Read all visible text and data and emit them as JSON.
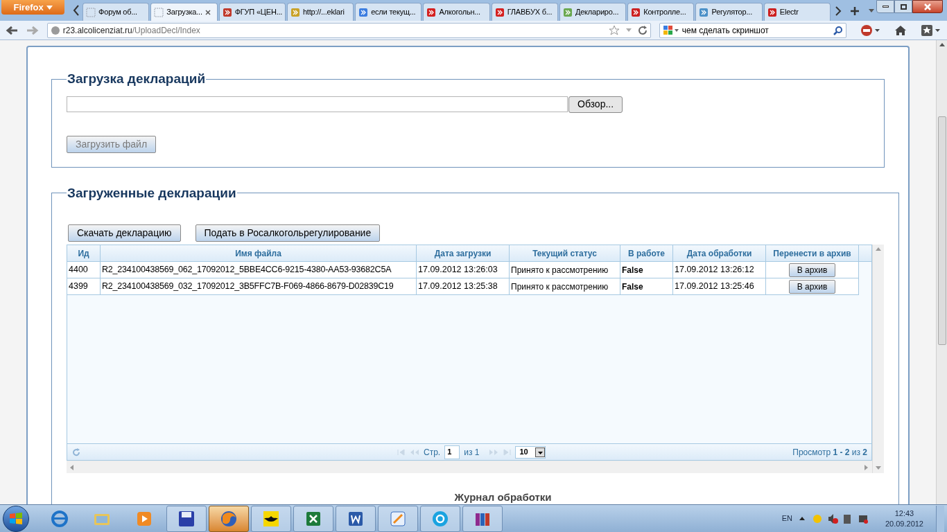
{
  "browser": {
    "menu_button": "Firefox",
    "tabs": [
      {
        "label": "Форум об...",
        "selected": false
      },
      {
        "label": "Загрузка...",
        "selected": true
      },
      {
        "label": "ФГУП «ЦЕН...",
        "selected": false
      },
      {
        "label": "http://...eklari",
        "selected": false
      },
      {
        "label": "если текущ...",
        "selected": false
      },
      {
        "label": "Алкогольн...",
        "selected": false
      },
      {
        "label": "ГЛАВБУХ б...",
        "selected": false
      },
      {
        "label": "Деклариро...",
        "selected": false
      },
      {
        "label": "Контролле...",
        "selected": false
      },
      {
        "label": "Регулятор...",
        "selected": false
      },
      {
        "label": "Electr",
        "selected": false
      }
    ],
    "url_host": "r23.alcolicenziat.ru",
    "url_path": "/UploadDecl/Index",
    "search_value": "чем сделать скриншот"
  },
  "upload": {
    "legend": "Загрузка деклараций",
    "browse_button": "Обзор...",
    "upload_button": {
      "label": "Загрузить файл",
      "disabled": true
    }
  },
  "uploaded": {
    "legend": "Загруженные декларации",
    "actions": [
      "Скачать декларацию",
      "Подать в Росалкогольрегулирование"
    ],
    "table": {
      "columns": [
        "Ид",
        "Имя файла",
        "Дата загрузки",
        "Текущий статус",
        "В работе",
        "Дата обработки",
        "Перенести в архив"
      ],
      "rows": [
        {
          "cells": [
            "4400",
            "R2_234100438569_062_17092012_5BBE4CC6-9215-4380-AA53-93682C5A",
            "17.09.2012 13:26:03",
            "Принято к рассмотрению",
            "False",
            "17.09.2012 13:26:12"
          ],
          "archive_button": "В архив"
        },
        {
          "cells": [
            "4399",
            "R2_234100438569_032_17092012_3B5FFC7B-F069-4866-8679-D02839C19",
            "17.09.2012 13:25:38",
            "Принято к рассмотрению",
            "False",
            "17.09.2012 13:25:46"
          ],
          "archive_button": "В архив"
        }
      ]
    },
    "pager": {
      "page_label": "Стр.",
      "page_value": "1",
      "of_label": "из 1",
      "page_size": "10",
      "summary": "Просмотр **1 - 2** из **2**"
    }
  },
  "journal_title": "Журнал обработки",
  "taskbar": {
    "apps": [
      {
        "selected": false
      },
      {
        "selected": false
      },
      {
        "selected": false
      },
      {
        "selected": false
      },
      {
        "selected": true
      },
      {
        "selected": false
      },
      {
        "selected": false
      },
      {
        "selected": false
      },
      {
        "selected": false
      },
      {
        "selected": false
      },
      {
        "selected": false
      }
    ],
    "language": "EN",
    "time": "12:43",
    "date": "20.09.2012"
  }
}
